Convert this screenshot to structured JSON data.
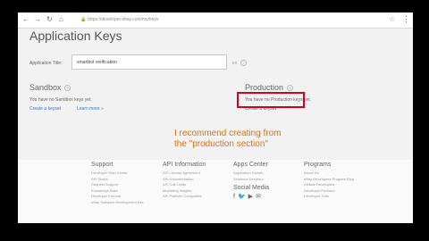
{
  "browser": {
    "url": "https://developer.ebay.com/my/keys",
    "nav": {
      "back": "←",
      "forward": "→",
      "reload": "↻",
      "home": "⌂"
    },
    "icons": {
      "lock": "lock-icon",
      "star": "star-icon",
      "menu": "menu-icon"
    }
  },
  "page": {
    "title": "Application Keys",
    "app_title_label": "Application Title:",
    "app_title_value": "smartbot verification",
    "app_title_suffix": "ex"
  },
  "sandbox": {
    "title": "Sandbox",
    "status": "You have no Sandbox keys yet.",
    "create_link": "Create a keyset",
    "learn_more": "Learn more »"
  },
  "production": {
    "title": "Production",
    "status": "You have no Production keys yet.",
    "create_link": "Create a keyset"
  },
  "annotation": "I recommend creating from the \"production section\"",
  "colors": {
    "highlight": "#d0021b",
    "annotation": "#d87410",
    "link": "#3b73b9"
  },
  "footer": {
    "support": {
      "title": "Support",
      "items": [
        "Developer Help Center",
        "API Status",
        "Request Support",
        "Knowledge Base",
        "Developer Forums",
        "eBay Software Development Kits"
      ]
    },
    "api_information": {
      "title": "API Information",
      "items": [
        "API License Agreement",
        "API Documentation",
        "API Call Limits",
        "Marketing Insights",
        "API Platform Compatible"
      ]
    },
    "apps_center": {
      "title": "Apps Center",
      "items": [
        "Application Growth",
        "Solutions Directory"
      ]
    },
    "social": {
      "title": "Social Media",
      "icons": [
        "f",
        "🐦",
        "▶",
        "✉"
      ]
    },
    "programs": {
      "title": "Programs",
      "items": [
        "About Us",
        "eBay Developers Program Blog",
        "Affiliate Developers",
        "Developer Partners",
        "Developer Jobs"
      ]
    }
  }
}
